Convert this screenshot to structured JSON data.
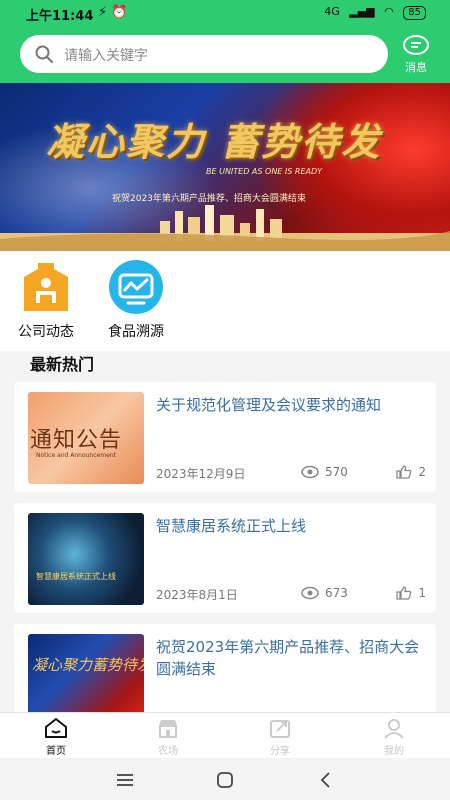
{
  "status_bar": {
    "time": "上午11:44",
    "battery": "85",
    "network": "4G"
  },
  "search": {
    "placeholder": "请输入关键字"
  },
  "header": {
    "message_label": "消息"
  },
  "banner": {
    "headline": "凝心聚力 蓄势待发",
    "tagline": "BE UNITED AS ONE IS READY",
    "subline": "祝贺2023年第六期产品推荐、招商大会圆满结束"
  },
  "quick_links": [
    {
      "label": "公司动态",
      "icon": "company-news-icon"
    },
    {
      "label": "食品溯源",
      "icon": "food-trace-icon"
    }
  ],
  "section": {
    "title": "最新热门"
  },
  "news": [
    {
      "title": "关于规范化管理及会议要求的通知",
      "thumb_text": "通知公告",
      "thumb_subtext": "Notice and Announcement",
      "date": "2023年12月9日",
      "views": "570",
      "likes": "2"
    },
    {
      "title": "智慧康居系统正式上线",
      "thumb_text": "智慧康居系统正式上线",
      "date": "2023年8月1日",
      "views": "673",
      "likes": "1"
    },
    {
      "title": "祝贺2023年第六期产品推荐、招商大会圆满结束",
      "thumb_text": "凝心聚力蓄势待发"
    }
  ],
  "bottom_nav": [
    {
      "label": "首页",
      "icon": "home-icon",
      "active": true
    },
    {
      "label": "农场",
      "icon": "farm-icon",
      "active": false
    },
    {
      "label": "分享",
      "icon": "share-icon",
      "active": false
    },
    {
      "label": "我的",
      "icon": "user-icon",
      "active": false
    }
  ],
  "colors": {
    "brand_green": "#2ecc71",
    "title_blue": "#3a6fa0",
    "accent_orange": "#f5a623",
    "accent_cyan": "#26b5e8"
  }
}
